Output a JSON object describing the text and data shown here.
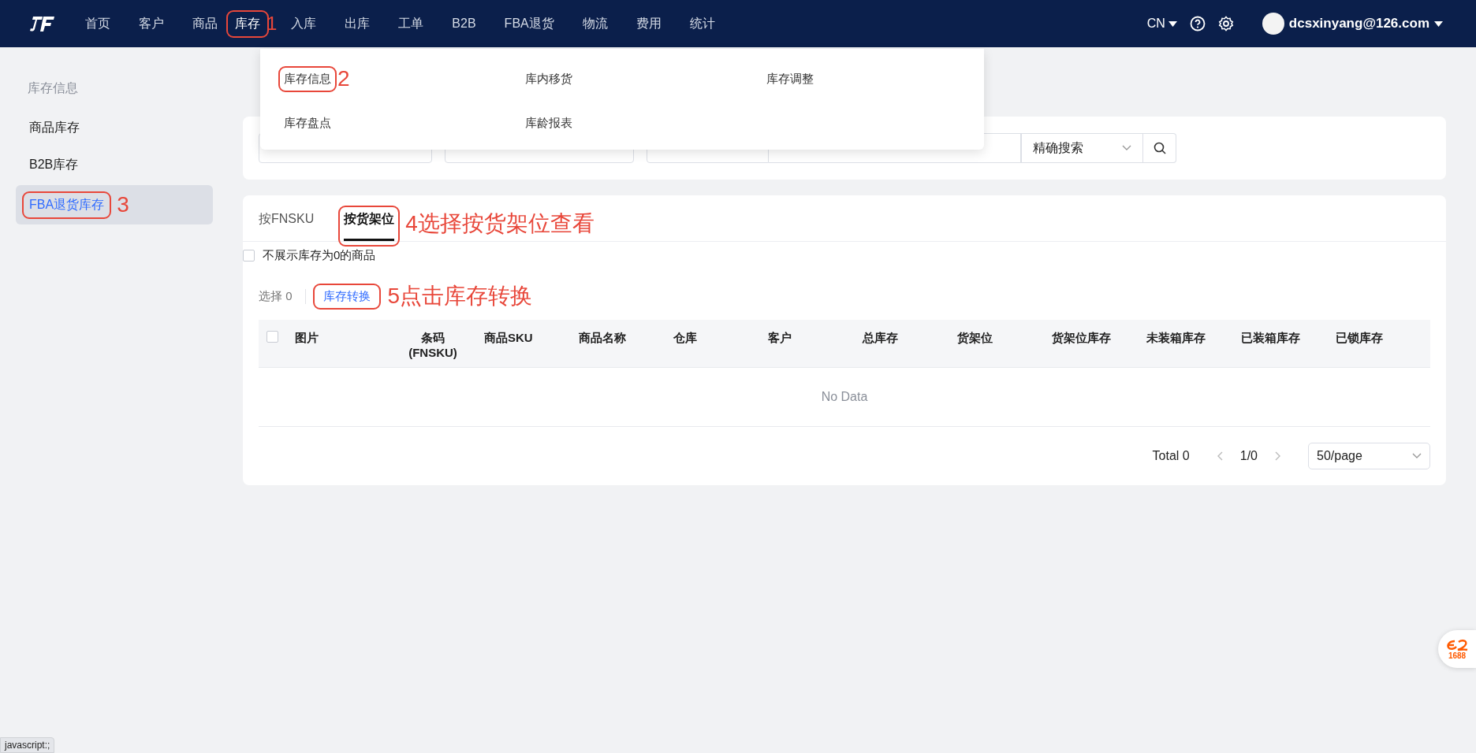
{
  "nav": {
    "items": [
      {
        "label": "首页",
        "selected": false
      },
      {
        "label": "客户",
        "selected": false
      },
      {
        "label": "商品",
        "selected": false
      },
      {
        "label": "库存",
        "selected": true,
        "annotation": "1"
      },
      {
        "label": "入库",
        "selected": false
      },
      {
        "label": "出库",
        "selected": false
      },
      {
        "label": "工单",
        "selected": false
      },
      {
        "label": "B2B",
        "selected": false
      },
      {
        "label": "FBA退货",
        "selected": false
      },
      {
        "label": "物流",
        "selected": false
      },
      {
        "label": "费用",
        "selected": false
      },
      {
        "label": "统计",
        "selected": false
      }
    ],
    "language": "CN",
    "user": "dcsxinyang@126.com"
  },
  "dropdown": {
    "items": [
      {
        "label": "库存信息",
        "annotation": "2"
      },
      {
        "label": "库内移货"
      },
      {
        "label": "库存调整"
      },
      {
        "label": "库存盘点"
      },
      {
        "label": "库龄报表"
      }
    ]
  },
  "sidebar": {
    "heading": "库存信息",
    "items": [
      {
        "label": "商品库存",
        "selected": false
      },
      {
        "label": "B2B库存",
        "selected": false
      },
      {
        "label": "FBA退货库存",
        "selected": true,
        "annotation": "3"
      }
    ]
  },
  "filters": {
    "match_mode": "精确搜索"
  },
  "tabs": [
    {
      "label": "按FNSKU",
      "selected": false
    },
    {
      "label": "按货架位",
      "selected": true,
      "annotation": "4选择按货架位查看"
    }
  ],
  "hide_zero": {
    "label": "不展示库存为0的商品",
    "checked": false
  },
  "selection": {
    "label": "选择",
    "count": "0"
  },
  "action": {
    "label": "库存转换",
    "annotation": "5点击库存转换"
  },
  "table": {
    "select_all_checked": false,
    "columns": [
      "图片",
      "条码 (FNSKU)",
      "商品SKU",
      "商品名称",
      "仓库",
      "客户",
      "总库存",
      "货架位",
      "货架位库存",
      "未装箱库存",
      "已装箱库存",
      "已锁库存"
    ],
    "empty": "No Data"
  },
  "pagination": {
    "total": "Total 0",
    "page": "1/0",
    "page_size": "50/page"
  },
  "badge": "1688",
  "status_bar": "javascript:;"
}
